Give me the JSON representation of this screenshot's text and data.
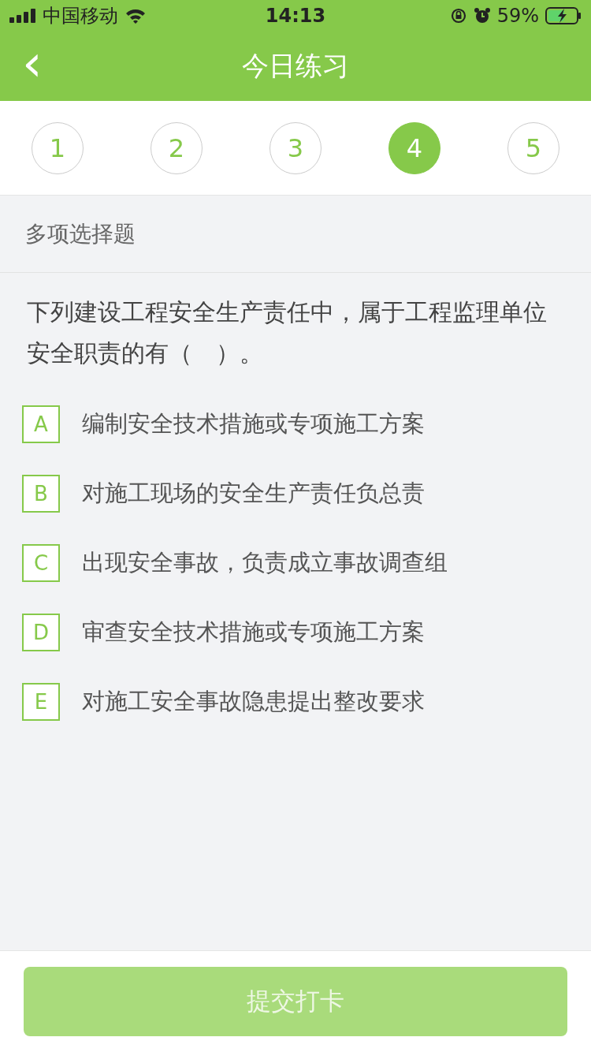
{
  "status_bar": {
    "carrier": "中国移动",
    "time": "14:13",
    "battery": "59%"
  },
  "nav": {
    "back": "‹",
    "title": "今日练习"
  },
  "question_tabs": [
    {
      "label": "1",
      "selected": false
    },
    {
      "label": "2",
      "selected": false
    },
    {
      "label": "3",
      "selected": false
    },
    {
      "label": "4",
      "selected": true
    },
    {
      "label": "5",
      "selected": false
    }
  ],
  "section": "多项选择题",
  "question": "下列建设工程安全生产责任中，属于工程监理单位安全职责的有（　）。",
  "options": [
    {
      "letter": "A",
      "text": "编制安全技术措施或专项施工方案",
      "selected": false
    },
    {
      "letter": "B",
      "text": "对施工现场的安全生产责任负总责",
      "selected": false
    },
    {
      "letter": "C",
      "text": "出现安全事故，负责成立事故调查组",
      "selected": false
    },
    {
      "letter": "D",
      "text": "审查安全技术措施或专项施工方案",
      "selected": false
    },
    {
      "letter": "E",
      "text": "对施工安全事故隐患提出整改要求",
      "selected": false
    }
  ],
  "submit": {
    "label": "提交打卡",
    "disabled": true
  }
}
